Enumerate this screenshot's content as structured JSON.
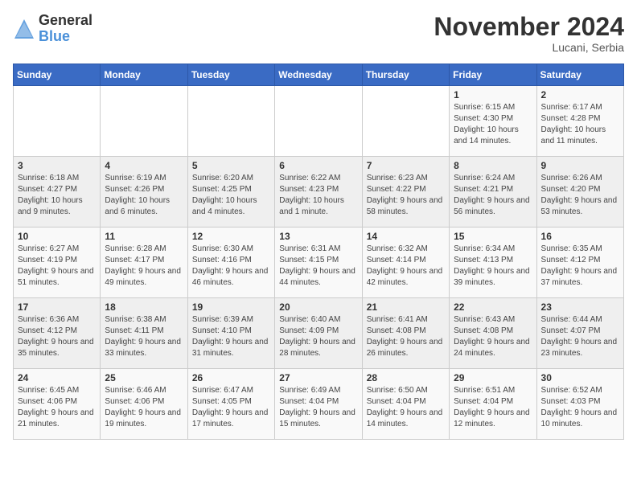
{
  "header": {
    "logo_general": "General",
    "logo_blue": "Blue",
    "month_title": "November 2024",
    "location": "Lucani, Serbia"
  },
  "weekdays": [
    "Sunday",
    "Monday",
    "Tuesday",
    "Wednesday",
    "Thursday",
    "Friday",
    "Saturday"
  ],
  "weeks": [
    [
      {
        "day": "",
        "info": ""
      },
      {
        "day": "",
        "info": ""
      },
      {
        "day": "",
        "info": ""
      },
      {
        "day": "",
        "info": ""
      },
      {
        "day": "",
        "info": ""
      },
      {
        "day": "1",
        "info": "Sunrise: 6:15 AM\nSunset: 4:30 PM\nDaylight: 10 hours and 14 minutes."
      },
      {
        "day": "2",
        "info": "Sunrise: 6:17 AM\nSunset: 4:28 PM\nDaylight: 10 hours and 11 minutes."
      }
    ],
    [
      {
        "day": "3",
        "info": "Sunrise: 6:18 AM\nSunset: 4:27 PM\nDaylight: 10 hours and 9 minutes."
      },
      {
        "day": "4",
        "info": "Sunrise: 6:19 AM\nSunset: 4:26 PM\nDaylight: 10 hours and 6 minutes."
      },
      {
        "day": "5",
        "info": "Sunrise: 6:20 AM\nSunset: 4:25 PM\nDaylight: 10 hours and 4 minutes."
      },
      {
        "day": "6",
        "info": "Sunrise: 6:22 AM\nSunset: 4:23 PM\nDaylight: 10 hours and 1 minute."
      },
      {
        "day": "7",
        "info": "Sunrise: 6:23 AM\nSunset: 4:22 PM\nDaylight: 9 hours and 58 minutes."
      },
      {
        "day": "8",
        "info": "Sunrise: 6:24 AM\nSunset: 4:21 PM\nDaylight: 9 hours and 56 minutes."
      },
      {
        "day": "9",
        "info": "Sunrise: 6:26 AM\nSunset: 4:20 PM\nDaylight: 9 hours and 53 minutes."
      }
    ],
    [
      {
        "day": "10",
        "info": "Sunrise: 6:27 AM\nSunset: 4:19 PM\nDaylight: 9 hours and 51 minutes."
      },
      {
        "day": "11",
        "info": "Sunrise: 6:28 AM\nSunset: 4:17 PM\nDaylight: 9 hours and 49 minutes."
      },
      {
        "day": "12",
        "info": "Sunrise: 6:30 AM\nSunset: 4:16 PM\nDaylight: 9 hours and 46 minutes."
      },
      {
        "day": "13",
        "info": "Sunrise: 6:31 AM\nSunset: 4:15 PM\nDaylight: 9 hours and 44 minutes."
      },
      {
        "day": "14",
        "info": "Sunrise: 6:32 AM\nSunset: 4:14 PM\nDaylight: 9 hours and 42 minutes."
      },
      {
        "day": "15",
        "info": "Sunrise: 6:34 AM\nSunset: 4:13 PM\nDaylight: 9 hours and 39 minutes."
      },
      {
        "day": "16",
        "info": "Sunrise: 6:35 AM\nSunset: 4:12 PM\nDaylight: 9 hours and 37 minutes."
      }
    ],
    [
      {
        "day": "17",
        "info": "Sunrise: 6:36 AM\nSunset: 4:12 PM\nDaylight: 9 hours and 35 minutes."
      },
      {
        "day": "18",
        "info": "Sunrise: 6:38 AM\nSunset: 4:11 PM\nDaylight: 9 hours and 33 minutes."
      },
      {
        "day": "19",
        "info": "Sunrise: 6:39 AM\nSunset: 4:10 PM\nDaylight: 9 hours and 31 minutes."
      },
      {
        "day": "20",
        "info": "Sunrise: 6:40 AM\nSunset: 4:09 PM\nDaylight: 9 hours and 28 minutes."
      },
      {
        "day": "21",
        "info": "Sunrise: 6:41 AM\nSunset: 4:08 PM\nDaylight: 9 hours and 26 minutes."
      },
      {
        "day": "22",
        "info": "Sunrise: 6:43 AM\nSunset: 4:08 PM\nDaylight: 9 hours and 24 minutes."
      },
      {
        "day": "23",
        "info": "Sunrise: 6:44 AM\nSunset: 4:07 PM\nDaylight: 9 hours and 23 minutes."
      }
    ],
    [
      {
        "day": "24",
        "info": "Sunrise: 6:45 AM\nSunset: 4:06 PM\nDaylight: 9 hours and 21 minutes."
      },
      {
        "day": "25",
        "info": "Sunrise: 6:46 AM\nSunset: 4:06 PM\nDaylight: 9 hours and 19 minutes."
      },
      {
        "day": "26",
        "info": "Sunrise: 6:47 AM\nSunset: 4:05 PM\nDaylight: 9 hours and 17 minutes."
      },
      {
        "day": "27",
        "info": "Sunrise: 6:49 AM\nSunset: 4:04 PM\nDaylight: 9 hours and 15 minutes."
      },
      {
        "day": "28",
        "info": "Sunrise: 6:50 AM\nSunset: 4:04 PM\nDaylight: 9 hours and 14 minutes."
      },
      {
        "day": "29",
        "info": "Sunrise: 6:51 AM\nSunset: 4:04 PM\nDaylight: 9 hours and 12 minutes."
      },
      {
        "day": "30",
        "info": "Sunrise: 6:52 AM\nSunset: 4:03 PM\nDaylight: 9 hours and 10 minutes."
      }
    ]
  ]
}
